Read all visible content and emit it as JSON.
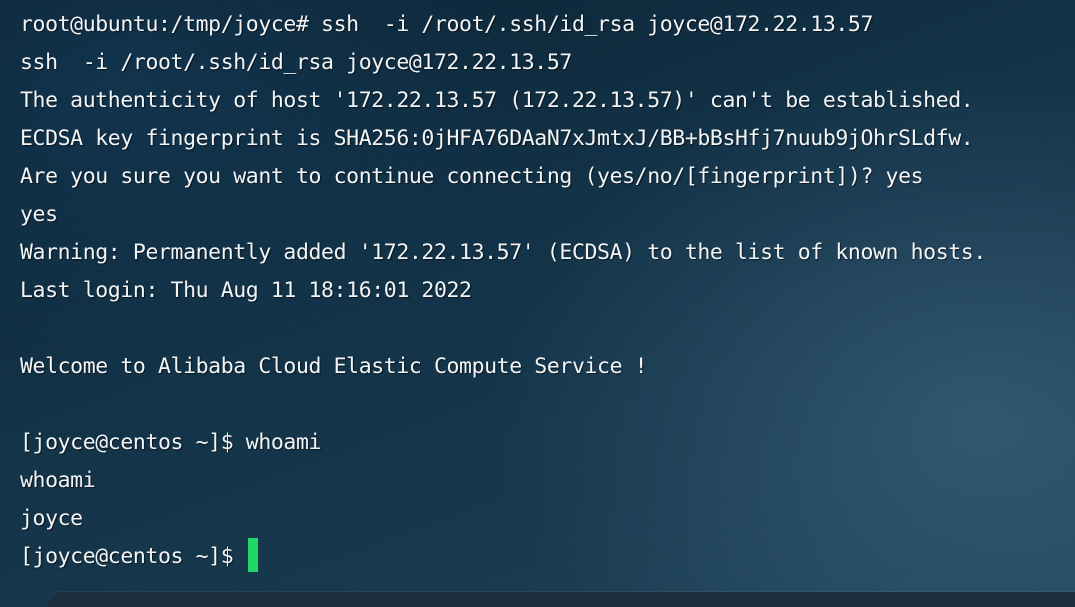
{
  "terminal": {
    "lines": [
      "root@ubuntu:/tmp/joyce# ssh  -i /root/.ssh/id_rsa joyce@172.22.13.57",
      "ssh  -i /root/.ssh/id_rsa joyce@172.22.13.57",
      "The authenticity of host '172.22.13.57 (172.22.13.57)' can't be established.",
      "ECDSA key fingerprint is SHA256:0jHFA76DAaN7xJmtxJ/BB+bBsHfj7nuub9jOhrSLdfw.",
      "Are you sure you want to continue connecting (yes/no/[fingerprint])? yes",
      "yes",
      "Warning: Permanently added '172.22.13.57' (ECDSA) to the list of known hosts.",
      "Last login: Thu Aug 11 18:16:01 2022",
      "",
      "Welcome to Alibaba Cloud Elastic Compute Service !",
      "",
      "[joyce@centos ~]$ whoami",
      "whoami",
      "joyce"
    ],
    "prompt": "[joyce@centos ~]$ ",
    "cursor_color": "#1fd86a",
    "text_color": "#f2f4f5"
  }
}
